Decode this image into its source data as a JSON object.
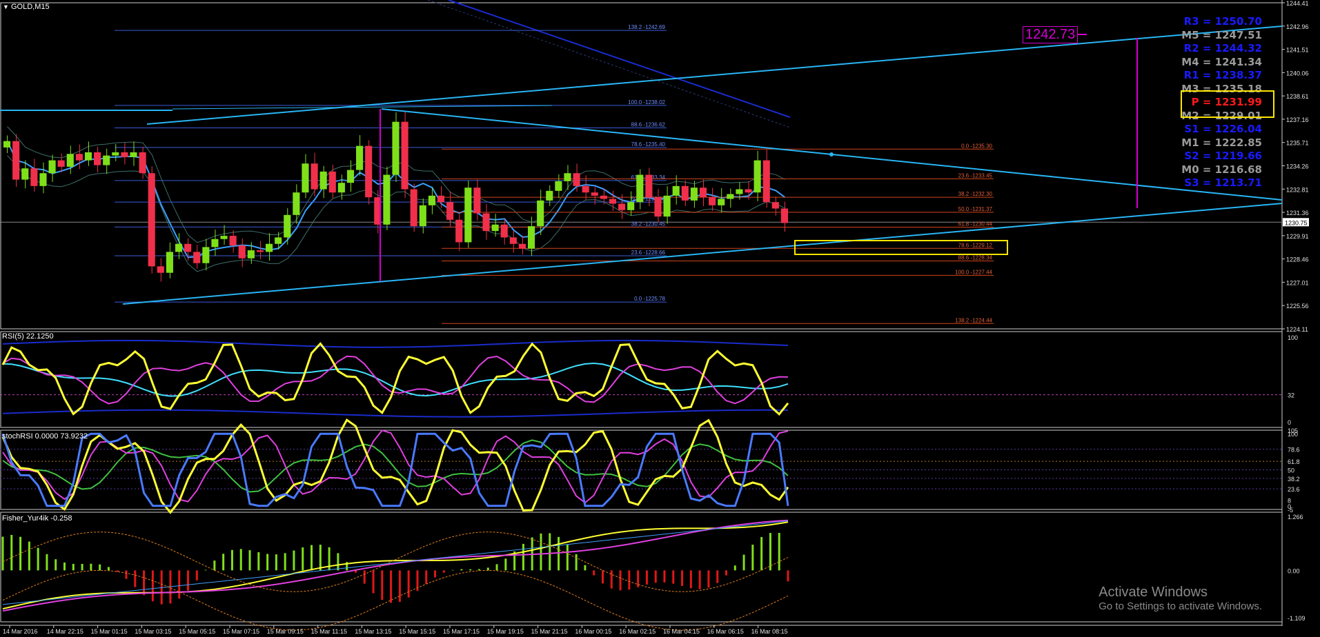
{
  "window": {
    "symbol_label": "GOLD,M15"
  },
  "panes": {
    "rsi_label": "RSI(5) 22.1250",
    "stochrsi_label": "stochRSI 0.0000 73.9232",
    "fisher_label": "Fisher_Yur4ik -0.258"
  },
  "price_axis": {
    "ticks": [
      "1244.41",
      "1242.96",
      "1241.51",
      "1240.06",
      "1238.61",
      "1237.16",
      "1235.71",
      "1234.26",
      "1232.81",
      "1231.36",
      "1229.91",
      "1228.46",
      "1227.01",
      "1225.56",
      "1224.11"
    ],
    "current_price": "1230.75"
  },
  "rsi_axis": {
    "ticks": [
      "100",
      "32",
      "0"
    ]
  },
  "stochrsi_axis": {
    "ticks": [
      "105",
      "100",
      "78.6",
      "61.8",
      "50",
      "38.2",
      "23.6",
      "8",
      "0",
      "-5"
    ]
  },
  "fisher_axis": {
    "ticks": [
      "1.266",
      "0.00",
      "-1.109"
    ]
  },
  "time_axis": {
    "ticks": [
      "14 Mar 2016",
      "14 Mar 22:15",
      "15 Mar 01:15",
      "15 Mar 03:15",
      "15 Mar 05:15",
      "15 Mar 07:15",
      "15 Mar 09:15",
      "15 Mar 11:15",
      "15 Mar 13:15",
      "15 Mar 15:15",
      "15 Mar 17:15",
      "15 Mar 19:15",
      "15 Mar 21:15",
      "16 Mar 00:15",
      "16 Mar 02:15",
      "16 Mar 04:15",
      "16 Mar 06:15",
      "16 Mar 08:15"
    ]
  },
  "fib_blue_labels": [
    "138.2 -1242.69",
    "100.0 -1238.02",
    "88.6 -1236.62",
    "78.6 -1235.40",
    "61.8 -1233.34",
    "50.0 -1232.00",
    "38.2 -1230.45",
    "23.6 -1228.66",
    "0.0 -1225.78"
  ],
  "fib_red_labels": [
    "0.0 -1235.30",
    "23.6 -1233.45",
    "38.2 -1232.30",
    "50.0 -1231.37",
    "61.8 -1230.44",
    "78.6 -1229.12",
    "88.6 -1228.34",
    "100.0 -1227.44",
    "138.2 -1224.44"
  ],
  "pivots": [
    {
      "text": "R3 = 1250.70",
      "color": "#1a1aff"
    },
    {
      "text": "M5 = 1247.51",
      "color": "#9a9a9a"
    },
    {
      "text": "R2 = 1244.32",
      "color": "#1a1aff"
    },
    {
      "text": "M4 = 1241.34",
      "color": "#9a9a9a"
    },
    {
      "text": "R1 = 1238.37",
      "color": "#1a1aff"
    },
    {
      "text": "M3 = 1235.18",
      "color": "#9a9a9a"
    },
    {
      "text": "P  = 1231.99",
      "color": "#ff1a1a"
    },
    {
      "text": "M2 = 1229.01",
      "color": "#9a9a9a"
    },
    {
      "text": "S1 = 1226.04",
      "color": "#1a1aff"
    },
    {
      "text": "M1 = 1222.85",
      "color": "#9a9a9a"
    },
    {
      "text": "S2 = 1219.66",
      "color": "#1a1aff"
    },
    {
      "text": "M0 = 1216.68",
      "color": "#9a9a9a"
    },
    {
      "text": "S3 = 1213.71",
      "color": "#1a1aff"
    }
  ],
  "target_tag": "1242.73",
  "watermark": {
    "line1": "Activate Windows",
    "line2": "Go to Settings to activate Windows."
  },
  "colors": {
    "bull": "#7fe01a",
    "bear": "#f0304a",
    "trend": "#29b6f6",
    "fib_blue": "#3a5bd9",
    "fib_red": "#d2441c",
    "rsi_main": "#ffff33"
  },
  "chart_data": {
    "type": "candlestick",
    "symbol": "GOLD",
    "timeframe": "M15",
    "ylim": [
      1224.11,
      1244.41
    ],
    "current_price": 1230.75,
    "candles_close": [
      1235.8,
      1233.4,
      1234.1,
      1233.0,
      1233.8,
      1234.6,
      1234.2,
      1235.0,
      1234.6,
      1235.1,
      1234.3,
      1234.9,
      1235.1,
      1234.8,
      1235.1,
      1233.8,
      1228.0,
      1227.6,
      1228.9,
      1229.4,
      1228.9,
      1228.2,
      1229.2,
      1229.7,
      1229.9,
      1229.3,
      1228.5,
      1229.0,
      1228.9,
      1229.4,
      1229.8,
      1231.2,
      1232.6,
      1234.4,
      1232.8,
      1233.9,
      1232.6,
      1233.2,
      1234.0,
      1235.5,
      1232.3,
      1230.6,
      1233.7,
      1237.0,
      1232.8,
      1230.5,
      1231.8,
      1232.4,
      1232.0,
      1230.9,
      1229.5,
      1232.9,
      1231.3,
      1230.2,
      1230.6,
      1229.8,
      1229.4,
      1229.1,
      1230.5,
      1232.1,
      1232.7,
      1233.3,
      1233.8,
      1233.0,
      1232.6,
      1232.4,
      1232.2,
      1231.9,
      1231.5,
      1232.0,
      1233.7,
      1232.3,
      1231.1,
      1232.4,
      1233.0,
      1232.1,
      1232.9,
      1232.3,
      1231.8,
      1232.2,
      1232.5,
      1232.8,
      1232.6,
      1234.6,
      1232.0,
      1231.6,
      1230.7
    ],
    "fib_blue": [
      {
        "level": 138.2,
        "price": 1242.69
      },
      {
        "level": 100.0,
        "price": 1238.02
      },
      {
        "level": 88.6,
        "price": 1236.62
      },
      {
        "level": 78.6,
        "price": 1235.4
      },
      {
        "level": 61.8,
        "price": 1233.34
      },
      {
        "level": 50.0,
        "price": 1232.0
      },
      {
        "level": 38.2,
        "price": 1230.45
      },
      {
        "level": 23.6,
        "price": 1228.66
      },
      {
        "level": 0.0,
        "price": 1225.78
      }
    ],
    "fib_red": [
      {
        "level": 0.0,
        "price": 1235.3
      },
      {
        "level": 23.6,
        "price": 1233.45
      },
      {
        "level": 38.2,
        "price": 1232.3
      },
      {
        "level": 50.0,
        "price": 1231.37
      },
      {
        "level": 61.8,
        "price": 1230.44
      },
      {
        "level": 78.6,
        "price": 1229.12
      },
      {
        "level": 88.6,
        "price": 1228.34
      },
      {
        "level": 100.0,
        "price": 1227.44
      },
      {
        "level": 138.2,
        "price": 1224.44
      }
    ],
    "pivots": {
      "R3": 1250.7,
      "M5": 1247.51,
      "R2": 1244.32,
      "M4": 1241.34,
      "R1": 1238.37,
      "M3": 1235.18,
      "P": 1231.99,
      "M2": 1229.01,
      "S1": 1226.04,
      "M1": 1222.85,
      "S2": 1219.66,
      "M0": 1216.68,
      "S3": 1213.71
    },
    "rsi": {
      "period": 5,
      "value": 22.125,
      "ylim": [
        0,
        100
      ],
      "level": 32
    },
    "stochrsi": {
      "values": [
        0.0,
        73.9232
      ],
      "ylim": [
        -5,
        105
      ],
      "levels": [
        78.6,
        61.8,
        50,
        38.2,
        23.6
      ]
    },
    "fisher": {
      "value": -0.258,
      "ylim": [
        -1.109,
        1.266
      ]
    }
  }
}
